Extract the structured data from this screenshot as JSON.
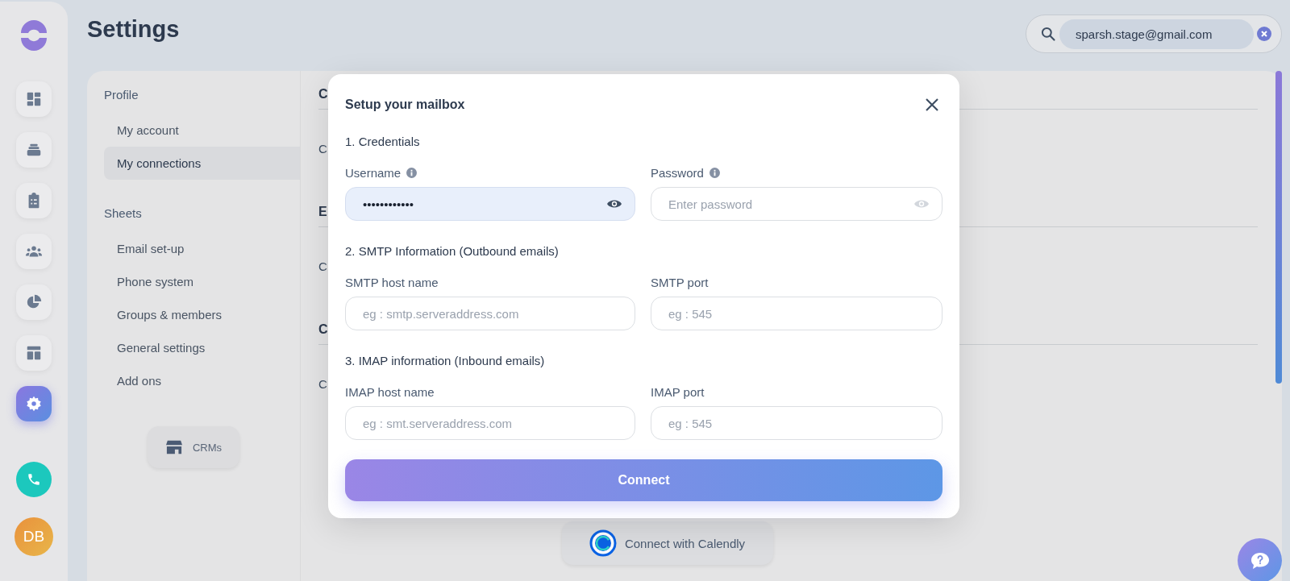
{
  "rail": {
    "items": [
      {
        "kind": "dashboard",
        "selected": false
      },
      {
        "kind": "stack",
        "selected": false
      },
      {
        "kind": "clipboard",
        "selected": false
      },
      {
        "kind": "people",
        "selected": false
      },
      {
        "kind": "pie",
        "selected": false
      },
      {
        "kind": "layout",
        "selected": false
      },
      {
        "kind": "settings",
        "selected": true
      }
    ],
    "avatar": "DB"
  },
  "header": {
    "title": "Settings"
  },
  "search": {
    "value": "sparsh.stage@gmail.com"
  },
  "settings_nav": {
    "groups": [
      {
        "heading": "Profile",
        "items": [
          {
            "label": "My account",
            "selected": false
          },
          {
            "label": "My connections",
            "selected": true
          }
        ]
      },
      {
        "heading": "Sheets",
        "items": [
          {
            "label": "Email set-up",
            "selected": false
          },
          {
            "label": "Phone system",
            "selected": false
          },
          {
            "label": "Groups & members",
            "selected": false
          },
          {
            "label": "General settings",
            "selected": false
          },
          {
            "label": "Add ons",
            "selected": false
          }
        ]
      }
    ],
    "crm_button": "CRMs"
  },
  "background_sections": [
    {
      "heading": "C",
      "row": "C"
    },
    {
      "heading": "E",
      "row": "C"
    },
    {
      "heading": "C",
      "row": "C"
    }
  ],
  "calendly_button": "Connect with Calendly",
  "modal": {
    "title": "Setup your mailbox",
    "sections": [
      {
        "heading": "1. Credentials",
        "fields": [
          {
            "label": "Username",
            "info": true,
            "value": "••••••••••••",
            "eye": true
          },
          {
            "label": "Password",
            "info": true,
            "placeholder": "Enter password",
            "eye": true
          }
        ]
      },
      {
        "heading": "2. SMTP Information (Outbound emails)",
        "fields": [
          {
            "label": "SMTP host name",
            "info": false,
            "placeholder": "eg : smtp.serveraddress.com",
            "eye": false
          },
          {
            "label": "SMTP port",
            "info": false,
            "placeholder": "eg : 545",
            "eye": false
          }
        ]
      },
      {
        "heading": "3. IMAP information (Inbound emails)",
        "fields": [
          {
            "label": "IMAP host name",
            "info": false,
            "placeholder": "eg : smt.serveraddress.com",
            "eye": false
          },
          {
            "label": "IMAP port",
            "info": false,
            "placeholder": "eg : 545",
            "eye": false
          }
        ]
      }
    ],
    "submit": "Connect"
  }
}
